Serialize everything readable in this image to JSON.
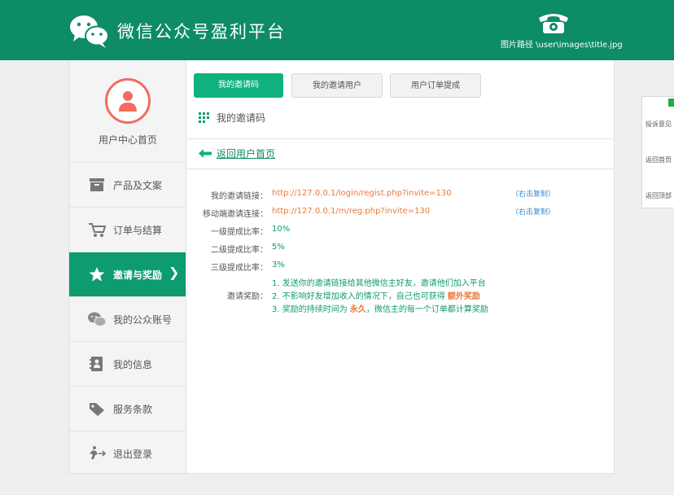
{
  "header": {
    "site_title": "微信公众号盈利平台",
    "image_path": "图片路径 \\user\\images\\title.jpg",
    "brand_color": "#0d8c67"
  },
  "sidebar": {
    "user_home": "用户中心首页",
    "items": [
      {
        "label": "产品及文案",
        "icon": "archive-box-icon"
      },
      {
        "label": "订单与结算",
        "icon": "shopping-cart-icon"
      },
      {
        "label": "邀请与奖励",
        "icon": "star-icon",
        "active": true,
        "chevron": "❯"
      },
      {
        "label": "我的公众账号",
        "icon": "wechat-icon"
      },
      {
        "label": "我的信息",
        "icon": "contact-card-icon"
      },
      {
        "label": "服务条款",
        "icon": "tag-icon"
      },
      {
        "label": "退出登录",
        "icon": "logout-runner-icon"
      }
    ],
    "active_color": "#0d9b6f"
  },
  "tabs": [
    {
      "label": "我的邀请码",
      "active": true
    },
    {
      "label": "我的邀请用户",
      "active": false
    },
    {
      "label": "用户订单提成",
      "active": false
    }
  ],
  "section_title": "我的邀请码",
  "back_link": "返回用户首页",
  "info": {
    "invite_link_label": "我的邀请链接：",
    "invite_link": "http://127.0.0.1/login/regist.php?invite=130",
    "mobile_link_label": "移动端邀请连接：",
    "mobile_link": "http://127.0.0.1/m/reg.php?invite=130",
    "copy_label": "（右击复制）",
    "level1_label": "一级提成比率：",
    "level1_value": "10%",
    "level2_label": "二级提成比率：",
    "level2_value": "5%",
    "level3_label": "三级提成比率：",
    "level3_value": "3%",
    "reward_label": "邀请奖励：",
    "reward_line1": "1. 发送你的邀请链接给其他微信主好友，邀请他们加入平台",
    "reward_line2_pre": "2. 不影响好友增加收入的情况下，自己也可获得 ",
    "reward_line2_hl": "额外奖励",
    "reward_line3_pre": "3. 奖励的持续时间为 ",
    "reward_line3_hl": "永久",
    "reward_line3_post": "，微信主的每一个订单都计算奖励"
  },
  "float_panel": {
    "items": [
      "投诉意见",
      "返回首页",
      "返回顶部"
    ]
  }
}
